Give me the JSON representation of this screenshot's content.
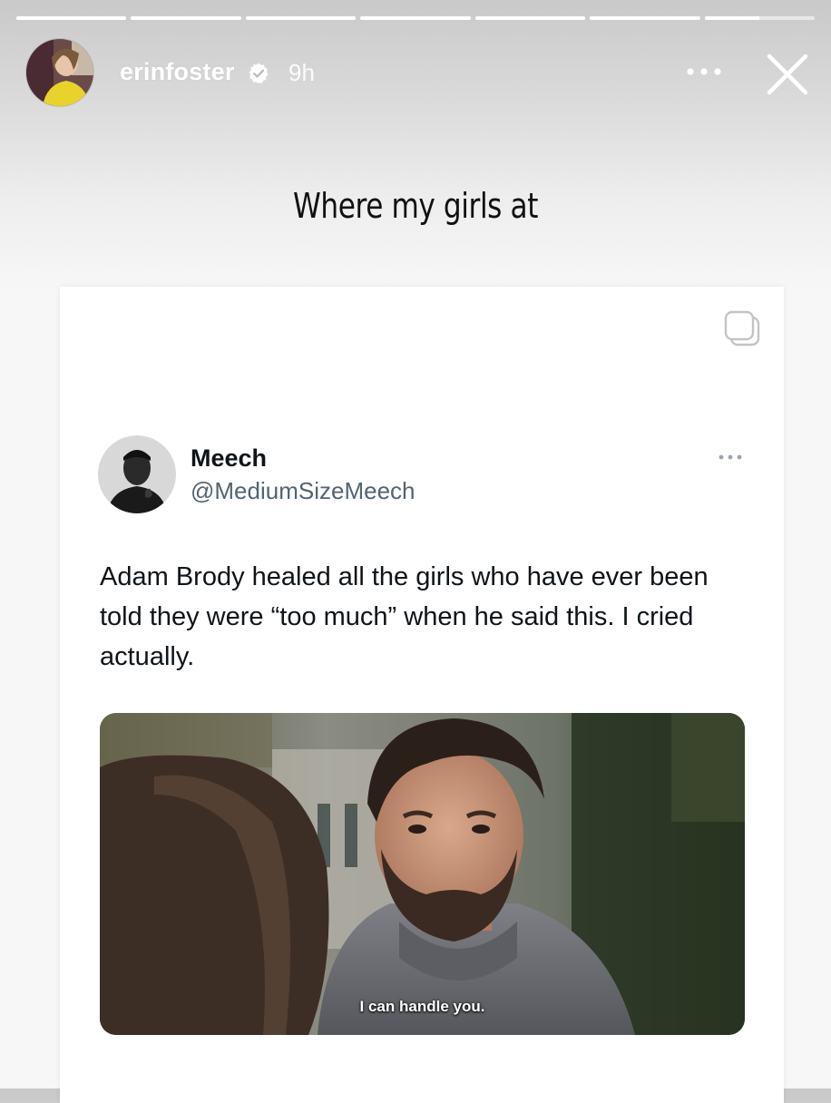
{
  "story": {
    "progress_segments": 7,
    "active_segment": 6,
    "active_fraction": 0.5,
    "user": {
      "username": "erinfoster",
      "verified": true,
      "time_ago": "9h"
    },
    "caption": "Where my girls at"
  },
  "tweet": {
    "display_name": "Meech",
    "handle": "@MediumSizeMeech",
    "text": "Adam Brody healed all the girls who have ever been told they were “too much” when he said this. I cried actually.",
    "media": {
      "subtitle": "I can handle you."
    }
  },
  "icons": {
    "verified": "verified-badge-icon",
    "more": "more-options-icon",
    "close": "close-icon",
    "copy": "copy-icon",
    "tweet_more": "tweet-more-icon"
  },
  "colors": {
    "verified_badge": "#ffffff",
    "text_dark": "#0f1419",
    "handle_gray": "#536471"
  }
}
